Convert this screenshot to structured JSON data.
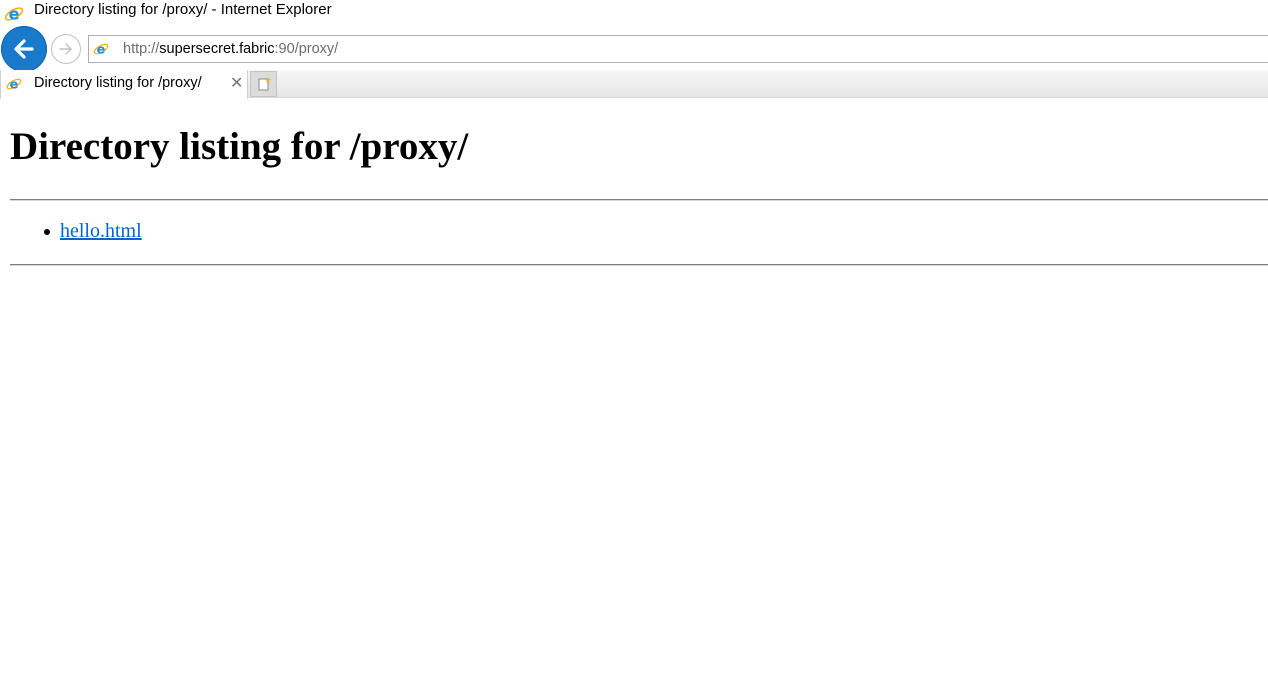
{
  "window": {
    "title": "Directory listing for /proxy/ - Internet Explorer",
    "app_icon": "internet-explorer-icon"
  },
  "nav": {
    "back_icon": "back-arrow-icon",
    "forward_icon": "forward-arrow-icon",
    "address": {
      "scheme": "http://",
      "host": "supersecret.fabric",
      "rest": ":90/proxy/"
    }
  },
  "tabs": [
    {
      "label": "Directory listing for /proxy/",
      "close_icon": "close-icon"
    }
  ],
  "new_tab_icon": "new-tab-icon",
  "page": {
    "heading": "Directory listing for /proxy/",
    "files": [
      {
        "name": "hello.html"
      }
    ]
  },
  "colors": {
    "back_button": "#1979ca",
    "link": "#0066cc"
  }
}
